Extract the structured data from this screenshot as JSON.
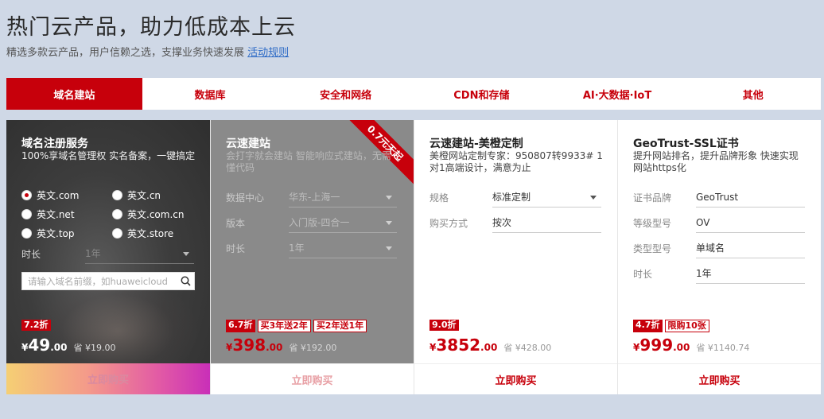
{
  "header": {
    "title": "热门云产品，助力低成本上云",
    "subtitle": "精选多款云产品，用户信赖之选，支撑业务快速发展",
    "rules_link": "活动规则"
  },
  "tabs": [
    {
      "label": "域名建站",
      "active": true
    },
    {
      "label": "数据库",
      "active": false
    },
    {
      "label": "安全和网络",
      "active": false
    },
    {
      "label": "CDN和存储",
      "active": false
    },
    {
      "label": "AI·大数据·IoT",
      "active": false
    },
    {
      "label": "其他",
      "active": false
    }
  ],
  "cards": [
    {
      "title": "域名注册服务",
      "desc": "100%享域名管理权 实名备案，一键搞定",
      "radios": [
        ".com",
        ".cn",
        ".net",
        ".com.cn",
        ".top",
        ".store"
      ],
      "radio_prefix": "英文",
      "selected_radio": 0,
      "duration_label": "时长",
      "duration_value": "1年",
      "search_placeholder": "请输入域名前缀，如huaweicloud",
      "badges": [
        "7.2折"
      ],
      "price": {
        "yen": "¥",
        "int": "49",
        "dec": ".00",
        "save": "省 ¥19.00"
      },
      "buy": "立即购买"
    },
    {
      "title": "云速建站",
      "desc": "会打字就会建站 智能响应式建站，无需懂代码",
      "ribbon": "0.7元天起",
      "fields": [
        {
          "label": "数据中心",
          "value": "华东-上海一"
        },
        {
          "label": "版本",
          "value": "入门版-四合一"
        },
        {
          "label": "时长",
          "value": "1年"
        }
      ],
      "badges": [
        "6.7折",
        "买3年送2年",
        "买2年送1年"
      ],
      "price": {
        "yen": "¥",
        "int": "398",
        "dec": ".00",
        "save": "省 ¥192.00"
      },
      "buy": "立即购买"
    },
    {
      "title": "云速建站-美橙定制",
      "desc": "美橙网站定制专家：950807转9933# 1对1高端设计，满意为止",
      "fields": [
        {
          "label": "规格",
          "value": "标准定制",
          "dropdown": true
        },
        {
          "label": "购买方式",
          "value": "按次"
        }
      ],
      "badges": [
        "9.0折"
      ],
      "price": {
        "yen": "¥",
        "int": "3852",
        "dec": ".00",
        "save": "省 ¥428.00"
      },
      "buy": "立即购买"
    },
    {
      "title": "GeoTrust-SSL证书",
      "desc": "提升网站排名，提升品牌形象 快速实现网站https化",
      "fields": [
        {
          "label": "证书品牌",
          "value": "GeoTrust"
        },
        {
          "label": "等级型号",
          "value": "OV"
        },
        {
          "label": "类型型号",
          "value": "单域名"
        },
        {
          "label": "时长",
          "value": "1年"
        }
      ],
      "badges": [
        "4.7折",
        "限购10张"
      ],
      "price": {
        "yen": "¥",
        "int": "999",
        "dec": ".00",
        "save": "省 ¥1140.74"
      },
      "buy": "立即购买"
    }
  ],
  "colors": {
    "brand": "#c7000b",
    "background": "#cfd8e6"
  }
}
